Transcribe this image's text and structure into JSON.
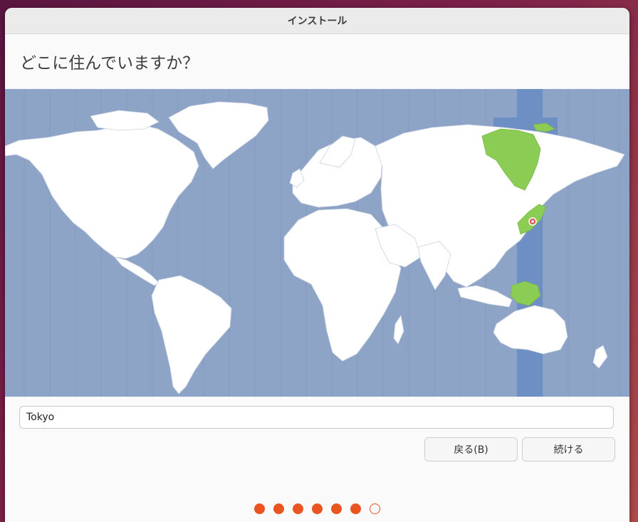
{
  "window": {
    "title": "インストール"
  },
  "page": {
    "heading": "どこに住んでいますか？"
  },
  "timezone": {
    "selected_city": "Tokyo",
    "marker_icon": "location-pin-icon",
    "colors": {
      "ocean": "#8ea4c7",
      "land": "#ffffff",
      "selected_band": "#6e8fc4",
      "highlight": "#8bcc55",
      "marker": "#e05a5a"
    }
  },
  "buttons": {
    "back": "戻る(B)",
    "continue": "続ける"
  },
  "progress": {
    "total_steps": 7,
    "current_step": 6,
    "accent": "#e95420"
  }
}
